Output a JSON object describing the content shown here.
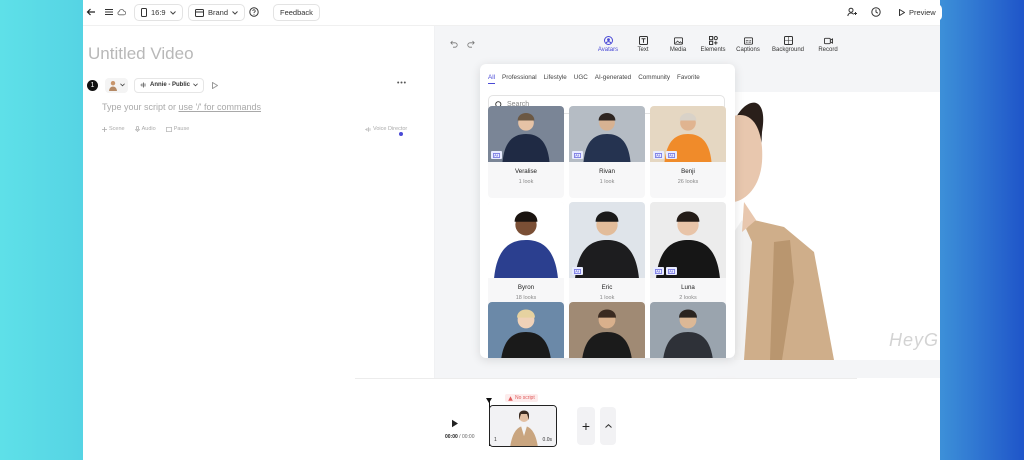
{
  "topbar": {
    "aspect_ratio": "16:9",
    "brand_label": "Brand",
    "feedback_label": "Feedback",
    "preview_label": "Preview"
  },
  "editor": {
    "title": "Untitled Video",
    "scene_number": "1",
    "voice_label": "Annie - Public",
    "script_placeholder_prefix": "Type your script or ",
    "script_placeholder_link": "use '/' for commands",
    "actions": [
      "Scene",
      "Audio",
      "Pause"
    ],
    "voice_director_label": "Voice Director"
  },
  "tools": [
    {
      "label": "Avatars",
      "icon": "avatar-icon",
      "active": true
    },
    {
      "label": "Text",
      "icon": "text-icon",
      "active": false
    },
    {
      "label": "Media",
      "icon": "media-icon",
      "active": false
    },
    {
      "label": "Elements",
      "icon": "elements-icon",
      "active": false
    },
    {
      "label": "Captions",
      "icon": "captions-icon",
      "active": false
    },
    {
      "label": "Background",
      "icon": "background-icon",
      "active": false
    },
    {
      "label": "Record",
      "icon": "record-icon",
      "active": false
    }
  ],
  "avatar_panel": {
    "tabs": [
      "All",
      "Professional",
      "Lifestyle",
      "UGC",
      "AI-generated",
      "Community",
      "Favorite"
    ],
    "active_tab": "All",
    "search_placeholder": "Search",
    "avatars": [
      {
        "name": "Veralise",
        "looks": "1 look",
        "bg": "#7a8596",
        "suit": "#1f2a44",
        "skin": "#e6c3a6",
        "hair": "#6b5844"
      },
      {
        "name": "Rivan",
        "looks": "1 look",
        "bg": "#b5bcc4",
        "suit": "#253350",
        "skin": "#d7b292",
        "hair": "#2d2420"
      },
      {
        "name": "Benji",
        "looks": "26 looks",
        "bg": "#e5d7c2",
        "suit": "#f08b2a",
        "skin": "#e0b490",
        "hair": "#d9d2c8"
      },
      {
        "name": "Byron",
        "looks": "18 looks",
        "bg": "#ffffff",
        "suit": "#2b3f8f",
        "skin": "#7a4f35",
        "hair": "#1a1410"
      },
      {
        "name": "Eric",
        "looks": "1 look",
        "bg": "#dfe4ea",
        "suit": "#1d1d1f",
        "skin": "#e2bc9a",
        "hair": "#1a1a1a"
      },
      {
        "name": "Luna",
        "looks": "2 looks",
        "bg": "#ececec",
        "suit": "#161616",
        "skin": "#e8c4a8",
        "hair": "#241c18"
      },
      {
        "name": "",
        "looks": "",
        "bg": "#6b89a8",
        "suit": "#1a1a1a",
        "skin": "#f0d2b8",
        "hair": "#e6d2a0"
      },
      {
        "name": "",
        "looks": "",
        "bg": "#a08a74",
        "suit": "#1b1b1b",
        "skin": "#d9b08c",
        "hair": "#3a2a20"
      },
      {
        "name": "",
        "looks": "",
        "bg": "#9aa4ae",
        "suit": "#2e3138",
        "skin": "#dcb896",
        "hair": "#2a2420"
      }
    ]
  },
  "watermark": "HeyG",
  "timeline": {
    "current_time": "00:00",
    "total_time": "00:00",
    "no_script_label": "No script",
    "scene_number": "1",
    "scene_duration": "0.0s",
    "add_label": "+"
  }
}
